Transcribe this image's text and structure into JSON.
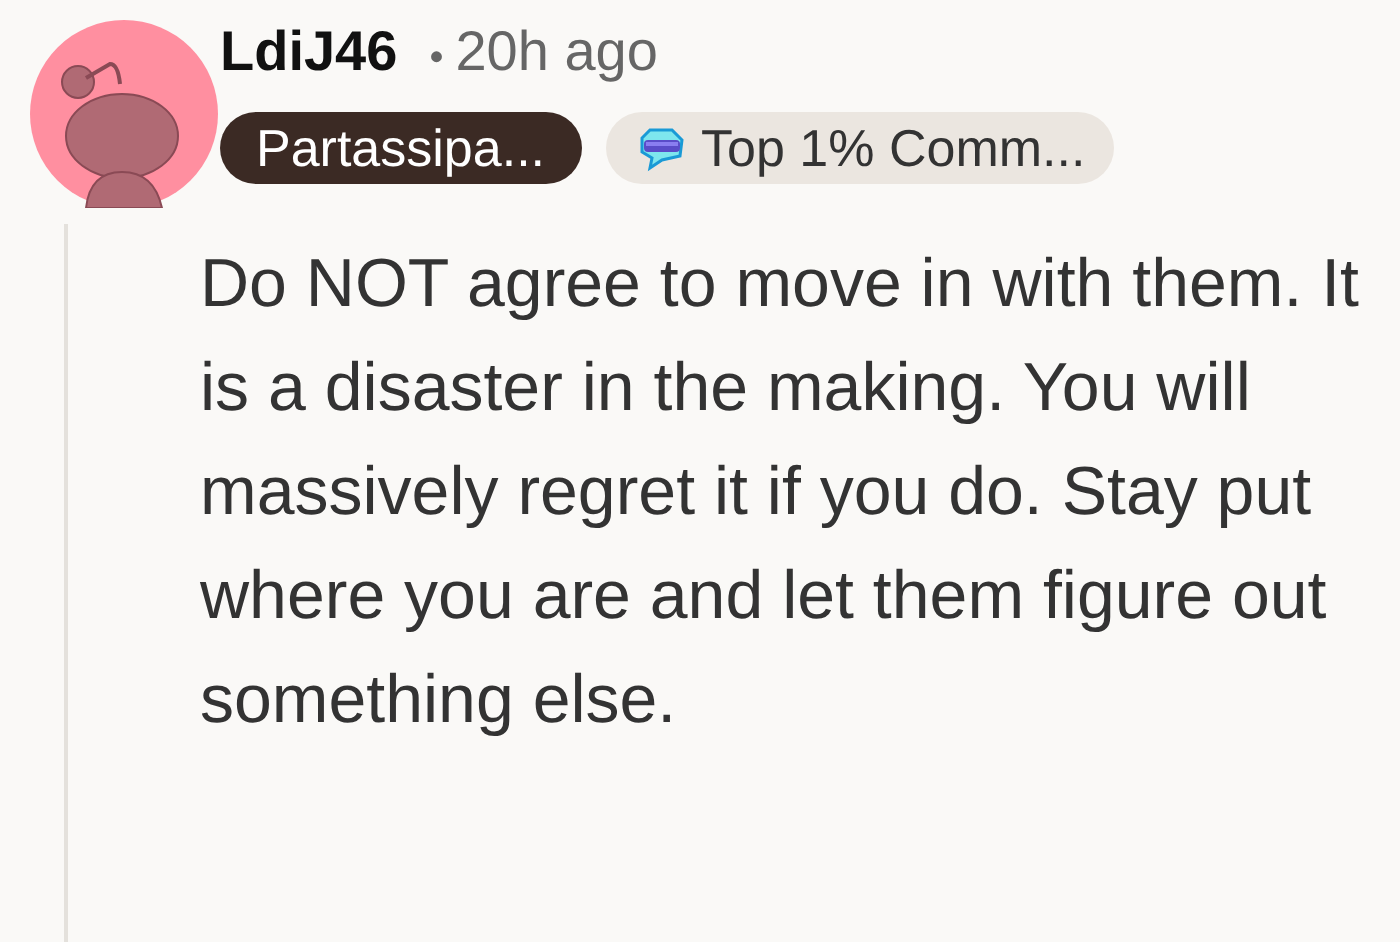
{
  "comment": {
    "author": "LdiJ46",
    "separator": "•",
    "time": "20h ago",
    "flairs": [
      {
        "kind": "user",
        "label": "Partassipa..."
      },
      {
        "kind": "achievement",
        "label": "Top 1% Comm..."
      }
    ],
    "body": "Do NOT agree to move in with them. It is a disaster in the making. You will massively regret it if you do. Stay put where you are and let them figure out something else."
  }
}
